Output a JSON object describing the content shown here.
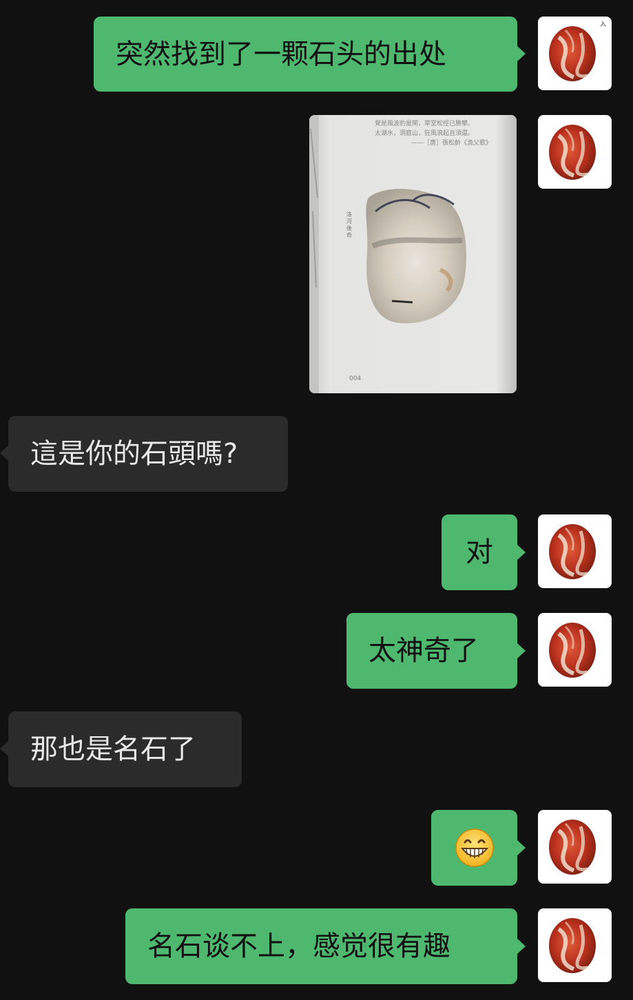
{
  "messages": [
    {
      "side": "right",
      "type": "text",
      "text": "突然找到了一颗石头的出处"
    },
    {
      "side": "right",
      "type": "image",
      "page_lines": [
        "覺是風波豹是閑，草堂松徑已勝攀。",
        "太湖水，洞庭山，狂風浪起且須還。",
        "——［唐］張松齡《漁父歌》"
      ],
      "vertical_caption": "洛河後奇",
      "page_number": "004"
    },
    {
      "side": "left",
      "type": "text",
      "text": "這是你的石頭嗎?"
    },
    {
      "side": "right",
      "type": "text",
      "text": "对"
    },
    {
      "side": "right",
      "type": "text",
      "text": "太神奇了"
    },
    {
      "side": "left",
      "type": "text",
      "text": "那也是名石了"
    },
    {
      "side": "right",
      "type": "emoji",
      "icon": "grinning-face-icon"
    },
    {
      "side": "right",
      "type": "text",
      "text": "名石谈不上，感觉很有趣"
    }
  ],
  "avatar": {
    "icon": "red-stone-avatar-icon"
  },
  "colors": {
    "background": "#111111",
    "outgoing": "#4eb96e",
    "incoming": "#2b2b2b",
    "incoming_text": "#e9e9e9"
  }
}
